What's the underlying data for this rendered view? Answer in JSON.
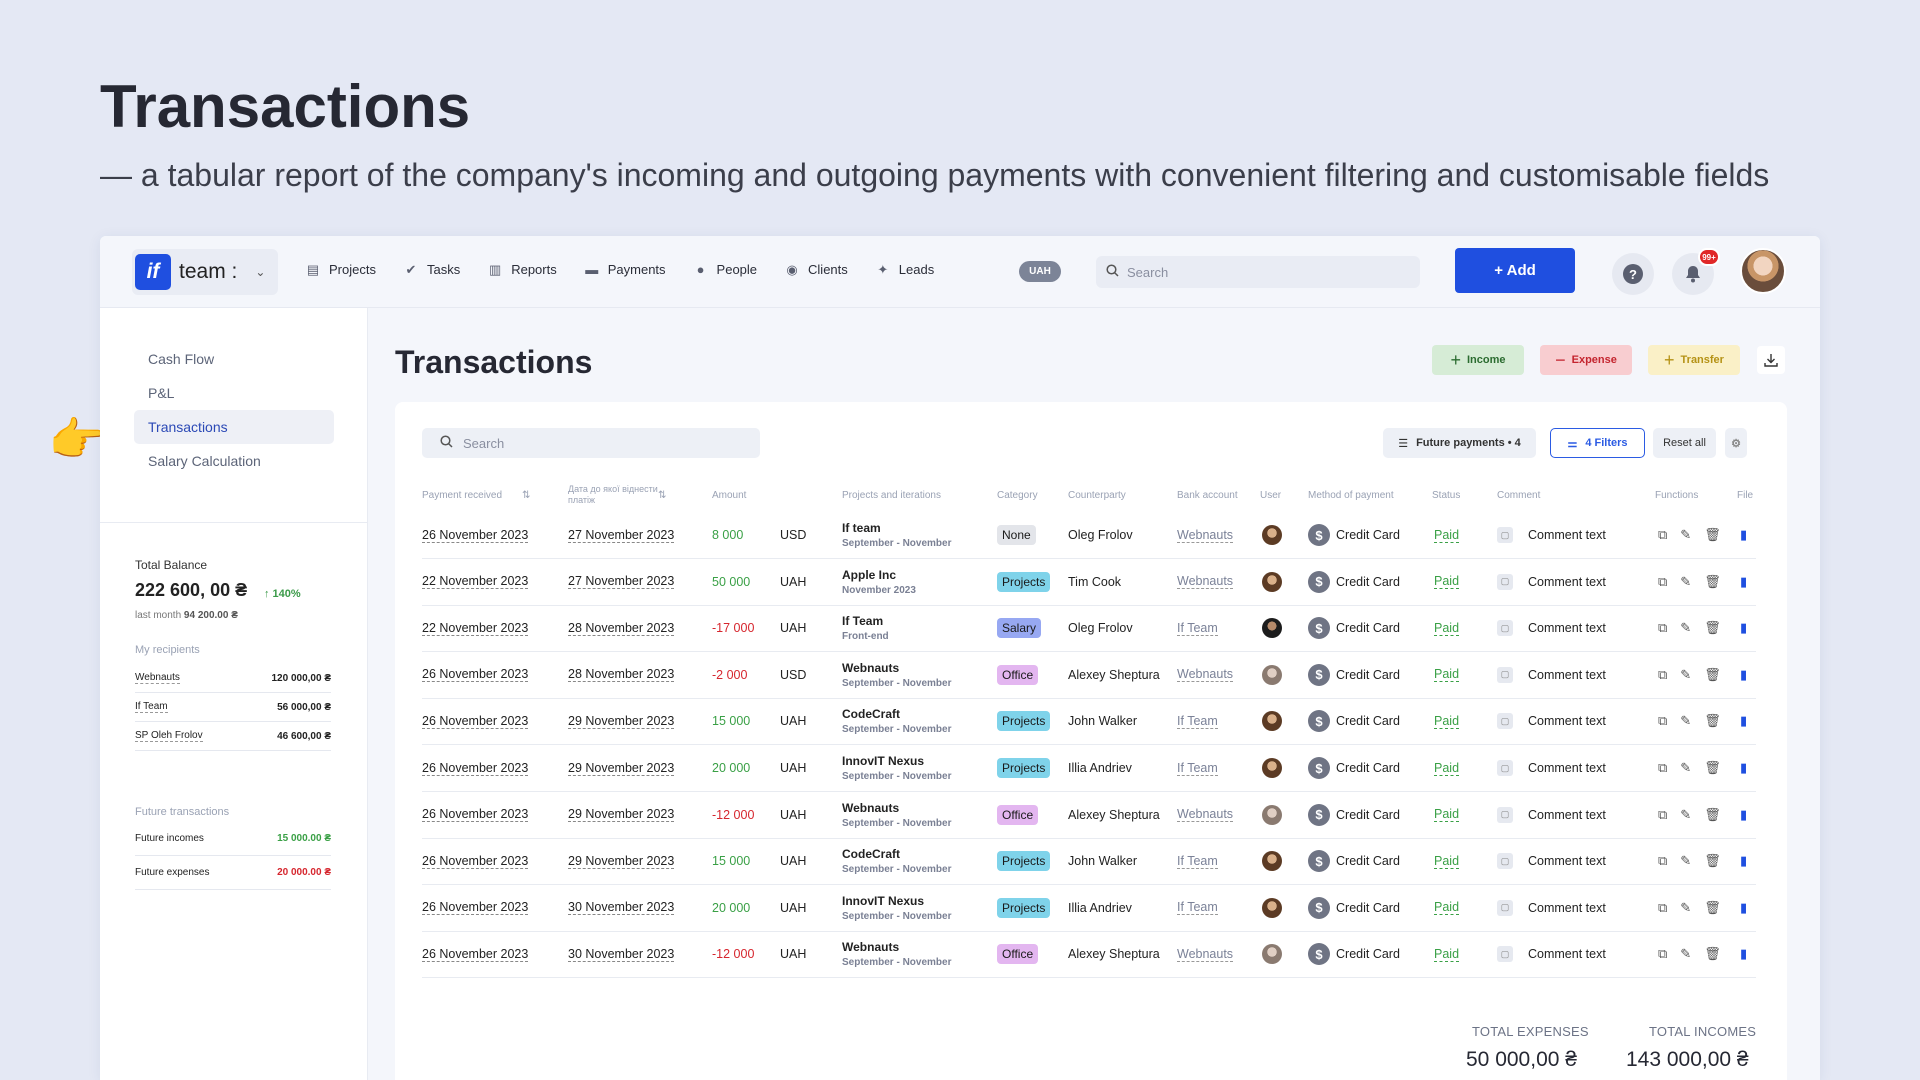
{
  "hero": {
    "title": "Transactions",
    "subtitle": "— a tabular report of the company's incoming and outgoing payments with convenient filtering and customisable fields"
  },
  "topbar": {
    "brand_logo": "if",
    "brand_name": "team :",
    "nav": [
      {
        "label": "Projects",
        "icon": "document-icon"
      },
      {
        "label": "Tasks",
        "icon": "check-circle-icon"
      },
      {
        "label": "Reports",
        "icon": "report-icon"
      },
      {
        "label": "Payments",
        "icon": "card-icon"
      },
      {
        "label": "People",
        "icon": "person-icon"
      },
      {
        "label": "Clients",
        "icon": "clients-icon"
      },
      {
        "label": "Leads",
        "icon": "leads-icon"
      }
    ],
    "currency": "UAH",
    "search_placeholder": "Search",
    "add_label": "+ Add",
    "help": "?",
    "notif_badge": "99+"
  },
  "sidebar": {
    "menu": [
      {
        "label": "Cash Flow",
        "active": false
      },
      {
        "label": "P&L",
        "active": false
      },
      {
        "label": "Transactions",
        "active": true
      },
      {
        "label": "Salary Calculation",
        "active": false
      }
    ],
    "total_balance_label": "Total Balance",
    "total_balance": "222 600, 00 ₴",
    "growth": "↑ 140%",
    "last_month_label": "last month",
    "last_month_value": "94 200.00 ₴",
    "recipients_title": "My recipients",
    "recipients": [
      {
        "name": "Webnauts",
        "value": "120 000,00 ₴"
      },
      {
        "name": "If Team",
        "value": "56 000,00 ₴"
      },
      {
        "name": "SP Oleh Frolov",
        "value": "46 600,00 ₴"
      }
    ],
    "future_title": "Future transactions",
    "future": [
      {
        "name": "Future incomes",
        "value": "15 000.00 ₴",
        "color": "#3aa046"
      },
      {
        "name": "Future expenses",
        "value": "20 000.00 ₴",
        "color": "#d6262e"
      }
    ]
  },
  "main": {
    "title": "Transactions",
    "actions": {
      "income": "Income",
      "expense": "Expense",
      "transfer": "Transfer"
    },
    "search_placeholder": "Search",
    "filter_future": "Future payments • 4",
    "filter_count": "4 Filters",
    "reset": "Reset all",
    "columns": [
      "Payment received",
      "Дата до якої віднести платіж",
      "Amount",
      "Projects and iterations",
      "Category",
      "Counterparty",
      "Bank account",
      "User",
      "Method  of payment",
      "Status",
      "Comment",
      "Functions",
      "File"
    ],
    "rows": [
      {
        "received": "26 November 2023",
        "assign": "27 November 2023",
        "amount": "8 000",
        "sign": "pos",
        "currency": "USD",
        "project": "If team",
        "iteration": "September - November",
        "category": "None",
        "catColor": "#e3e5ea",
        "counterparty": "Oleg Frolov",
        "bank": "Webnauts",
        "user": "#5c3b24",
        "method": "Credit Card",
        "status": "Paid",
        "comment": "Comment text"
      },
      {
        "received": "22 November 2023",
        "assign": "27 November 2023",
        "amount": "50 000",
        "sign": "pos",
        "currency": "UAH",
        "project": "Apple Inc",
        "iteration": "November 2023",
        "category": "Projects",
        "catColor": "#7fd3ea",
        "counterparty": "Tim Cook",
        "bank": "Webnauts",
        "user": "#5c3b24",
        "method": "Credit Card",
        "status": "Paid",
        "comment": "Comment text"
      },
      {
        "received": "22 November 2023",
        "assign": "28 November 2023",
        "amount": "-17 000",
        "sign": "neg",
        "currency": "UAH",
        "project": "If Team",
        "iteration": "Front-end",
        "category": "Salary",
        "catColor": "#97a8f2",
        "counterparty": "Oleg Frolov",
        "bank": "If Team",
        "user": "#1c1c1c",
        "method": "Credit Card",
        "status": "Paid",
        "comment": "Comment text"
      },
      {
        "received": "26 November 2023",
        "assign": "28 November 2023",
        "amount": "-2 000",
        "sign": "neg",
        "currency": "USD",
        "project": "Webnauts",
        "iteration": "September - November",
        "category": "Office",
        "catColor": "#e3b6f0",
        "counterparty": "Alexey Sheptura",
        "bank": "Webnauts",
        "user": "#8a7a70",
        "method": "Credit Card",
        "status": "Paid",
        "comment": "Comment text"
      },
      {
        "received": "26 November 2023",
        "assign": "29 November 2023",
        "amount": "15 000",
        "sign": "pos",
        "currency": "UAH",
        "project": "CodeCraft",
        "iteration": "September - November",
        "category": "Projects",
        "catColor": "#7fd3ea",
        "counterparty": "John Walker",
        "bank": "If Team",
        "user": "#5c3b24",
        "method": "Credit Card",
        "status": "Paid",
        "comment": "Comment text"
      },
      {
        "received": "26 November 2023",
        "assign": "29 November 2023",
        "amount": "20 000",
        "sign": "pos",
        "currency": "UAH",
        "project": "InnovIT Nexus",
        "iteration": "September - November",
        "category": "Projects",
        "catColor": "#7fd3ea",
        "counterparty": "Illia Andriev",
        "bank": "If Team",
        "user": "#5c3b24",
        "method": "Credit Card",
        "status": "Paid",
        "comment": "Comment text"
      },
      {
        "received": "26 November 2023",
        "assign": "29 November 2023",
        "amount": "-12 000",
        "sign": "neg",
        "currency": "UAH",
        "project": "Webnauts",
        "iteration": "September - November",
        "category": "Office",
        "catColor": "#e3b6f0",
        "counterparty": "Alexey Sheptura",
        "bank": "Webnauts",
        "user": "#8a7a70",
        "method": "Credit Card",
        "status": "Paid",
        "comment": "Comment text"
      },
      {
        "received": "26 November 2023",
        "assign": "29 November 2023",
        "amount": "15 000",
        "sign": "pos",
        "currency": "UAH",
        "project": "CodeCraft",
        "iteration": "September - November",
        "category": "Projects",
        "catColor": "#7fd3ea",
        "counterparty": "John Walker",
        "bank": "If Team",
        "user": "#5c3b24",
        "method": "Credit Card",
        "status": "Paid",
        "comment": "Comment text"
      },
      {
        "received": "26 November 2023",
        "assign": "30 November 2023",
        "amount": "20 000",
        "sign": "pos",
        "currency": "UAH",
        "project": "InnovIT Nexus",
        "iteration": "September - November",
        "category": "Projects",
        "catColor": "#7fd3ea",
        "counterparty": "Illia Andriev",
        "bank": "If Team",
        "user": "#5c3b24",
        "method": "Credit Card",
        "status": "Paid",
        "comment": "Comment text"
      },
      {
        "received": "26 November 2023",
        "assign": "30 November 2023",
        "amount": "-12 000",
        "sign": "neg",
        "currency": "UAH",
        "project": "Webnauts",
        "iteration": "September - November",
        "category": "Office",
        "catColor": "#e3b6f0",
        "counterparty": "Alexey Sheptura",
        "bank": "Webnauts",
        "user": "#8a7a70",
        "method": "Credit Card",
        "status": "Paid",
        "comment": "Comment text"
      }
    ],
    "totals": {
      "expenses_label": "TOTAL EXPENSES",
      "expenses": "50 000,00 ₴",
      "incomes_label": "TOTAL INCOMES",
      "incomes": "143 000,00 ₴"
    }
  }
}
